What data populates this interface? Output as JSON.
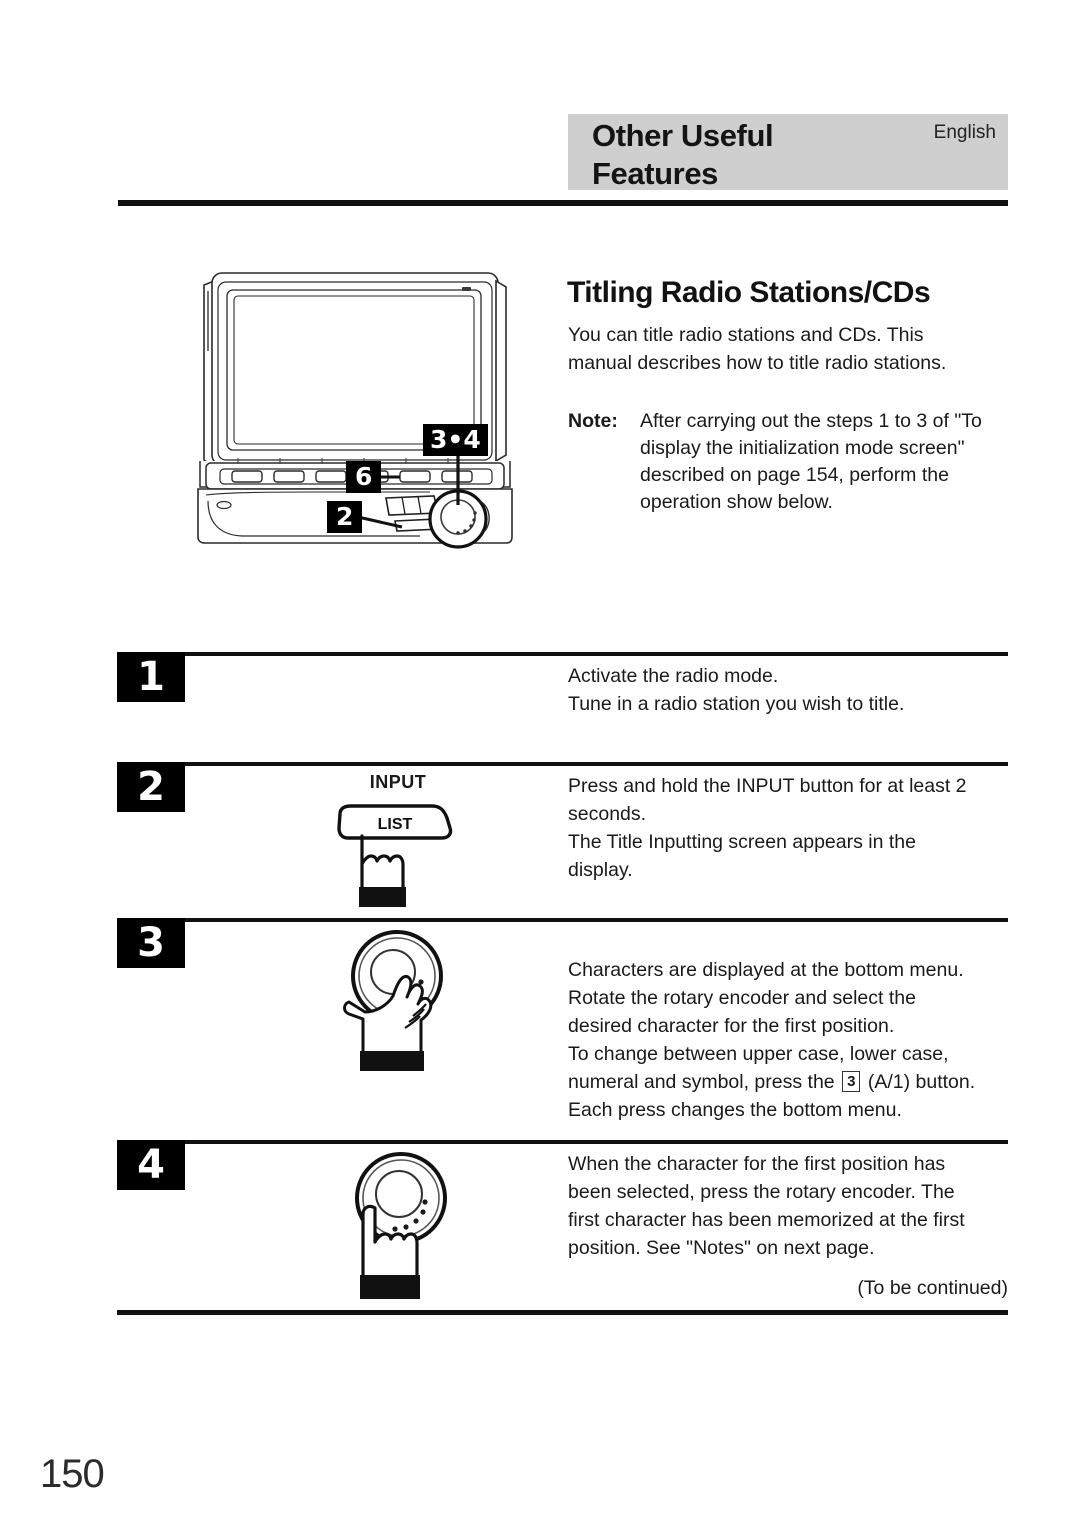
{
  "header": {
    "title": "Other Useful\nFeatures",
    "language": "English",
    "band_color": "#cfcfcf"
  },
  "section": {
    "title": "Titling Radio Stations/CDs",
    "intro": "You can title radio stations and CDs. This\nmanual describes how to title radio stations.",
    "note_label": "Note:",
    "note_body": "After carrying out the steps 1 to 3 of \"To\ndisplay the initialization mode screen\"\ndescribed on page 154, perform the\noperation show below."
  },
  "device": {
    "callouts": [
      {
        "label": "3•4",
        "target": "rotary-encoder"
      },
      {
        "label": "6",
        "target": "preset-button"
      },
      {
        "label": "2",
        "target": "input-list-button"
      }
    ]
  },
  "steps": [
    {
      "number": "1",
      "figure": "none",
      "figure_label": "",
      "text": "Activate the radio mode.\nTune in a radio station you wish to title."
    },
    {
      "number": "2",
      "figure": "list-button-press-icon",
      "figure_label": "INPUT",
      "button_label": "LIST",
      "text": "Press and hold the INPUT button for at least 2\nseconds.\nThe Title Inputting screen appears in the\ndisplay."
    },
    {
      "number": "3",
      "figure": "rotary-encoder-rotate-icon",
      "figure_label": "",
      "text_part1": "Characters are displayed at the bottom menu.\nRotate the rotary encoder and select the\ndesired character for the first position.\nTo change between upper case, lower case,\nnumeral and symbol, press the ",
      "inline_ref": "3",
      "text_part2": " (A/1) button.\nEach press changes the bottom menu."
    },
    {
      "number": "4",
      "figure": "rotary-encoder-press-icon",
      "figure_label": "",
      "text": "When the character for the first position has\nbeen selected, press the rotary encoder. The\nfirst character has been memorized at the first\nposition. See \"Notes\" on next page."
    }
  ],
  "footer": {
    "to_be_continued": "(To be continued)",
    "page_number": "150"
  }
}
